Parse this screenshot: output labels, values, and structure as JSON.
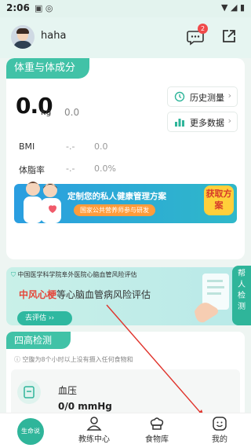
{
  "status": {
    "time": "2:06"
  },
  "header": {
    "username": "haha",
    "badge_count": "2"
  },
  "card1": {
    "title": "体重与体成分",
    "weight_value": "0.0",
    "weight_unit": "kg",
    "secondary_value": "0.0",
    "history_button": "历史测量",
    "more_button": "更多数据",
    "rows": [
      {
        "label": "BMI",
        "v1": "-.-",
        "v2": "0.0"
      },
      {
        "label": "体脂率",
        "v1": "-.-",
        "v2": "0.0%"
      }
    ]
  },
  "banner1": {
    "headline": "定制您的私人健康管理方案",
    "subline": "国家公共营养师参与研发",
    "cta": "获取方案"
  },
  "card2": {
    "source": "中国医学科学院阜外医院心脑血管风险评估",
    "title_red": "中风心梗",
    "title_rest": "等心脑血管病风险评估",
    "button": "去评估 ››"
  },
  "side_tab": {
    "label": "帮人检测"
  },
  "card3": {
    "title": "四高检测",
    "tip": "空腹为8个小时以上没有摄入任何食物和",
    "item_name": "血压",
    "item_value": "0/0 mmHg"
  },
  "tabbar": {
    "home": "生命说",
    "coach": "教练中心",
    "food": "食物库",
    "mine": "我的"
  }
}
